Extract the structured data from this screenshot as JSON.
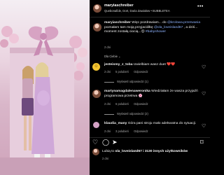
{
  "post": {
    "username": "maryiaschreiber",
    "subtitle": "Quebonafide, Dort, Daria Zawiałow • BUBBLETEA",
    "caption_text": "Więc pozdrawiam... do",
    "caption_link1": "@krolowa.przerwania",
    "caption_mid": "poznałam tam moją przyjaciółkę",
    "caption_link2": "@ola_loveisland67",
    "caption_tail": ", a dziś... moment zostałą ciocią...😊",
    "caption_tag": "#babyshower",
    "caption_time": "2 dni",
    "more_icon": "•••"
  },
  "section_label": "Dla Ciebie ⌄",
  "comments": [
    {
      "username": "jesteismy_z_toba",
      "text": "Uwielbiam wasz duet ❤️❤️",
      "time": "2 dni",
      "likes": "5 polubień",
      "reply": "Odpowiedz",
      "replies_label": "Wyświetl odpowiedzi (1)"
    },
    {
      "username": "martynamagdalenaweronika",
      "text": "Wiedziałam że wasza przyjaźń programowa przetrwa 🌸",
      "time": "2 dni",
      "likes": "6 polubień",
      "reply": "Odpowiedz",
      "replies_label": "Wyświetl odpowiedzi (2)"
    },
    {
      "username": "klaudia_many",
      "text": "Góra pani stroju mało adekwatna do sytuacji.",
      "time": "2 dni",
      "likes": "3 polubień",
      "reply": "Odpowiedz",
      "replies_label": ""
    }
  ],
  "footer": {
    "likes_prefix": "Lubią to",
    "likes_user": "ola_loveisland67",
    "likes_suffix": "i 3130 innych użytkowników",
    "time": "2 dni"
  }
}
